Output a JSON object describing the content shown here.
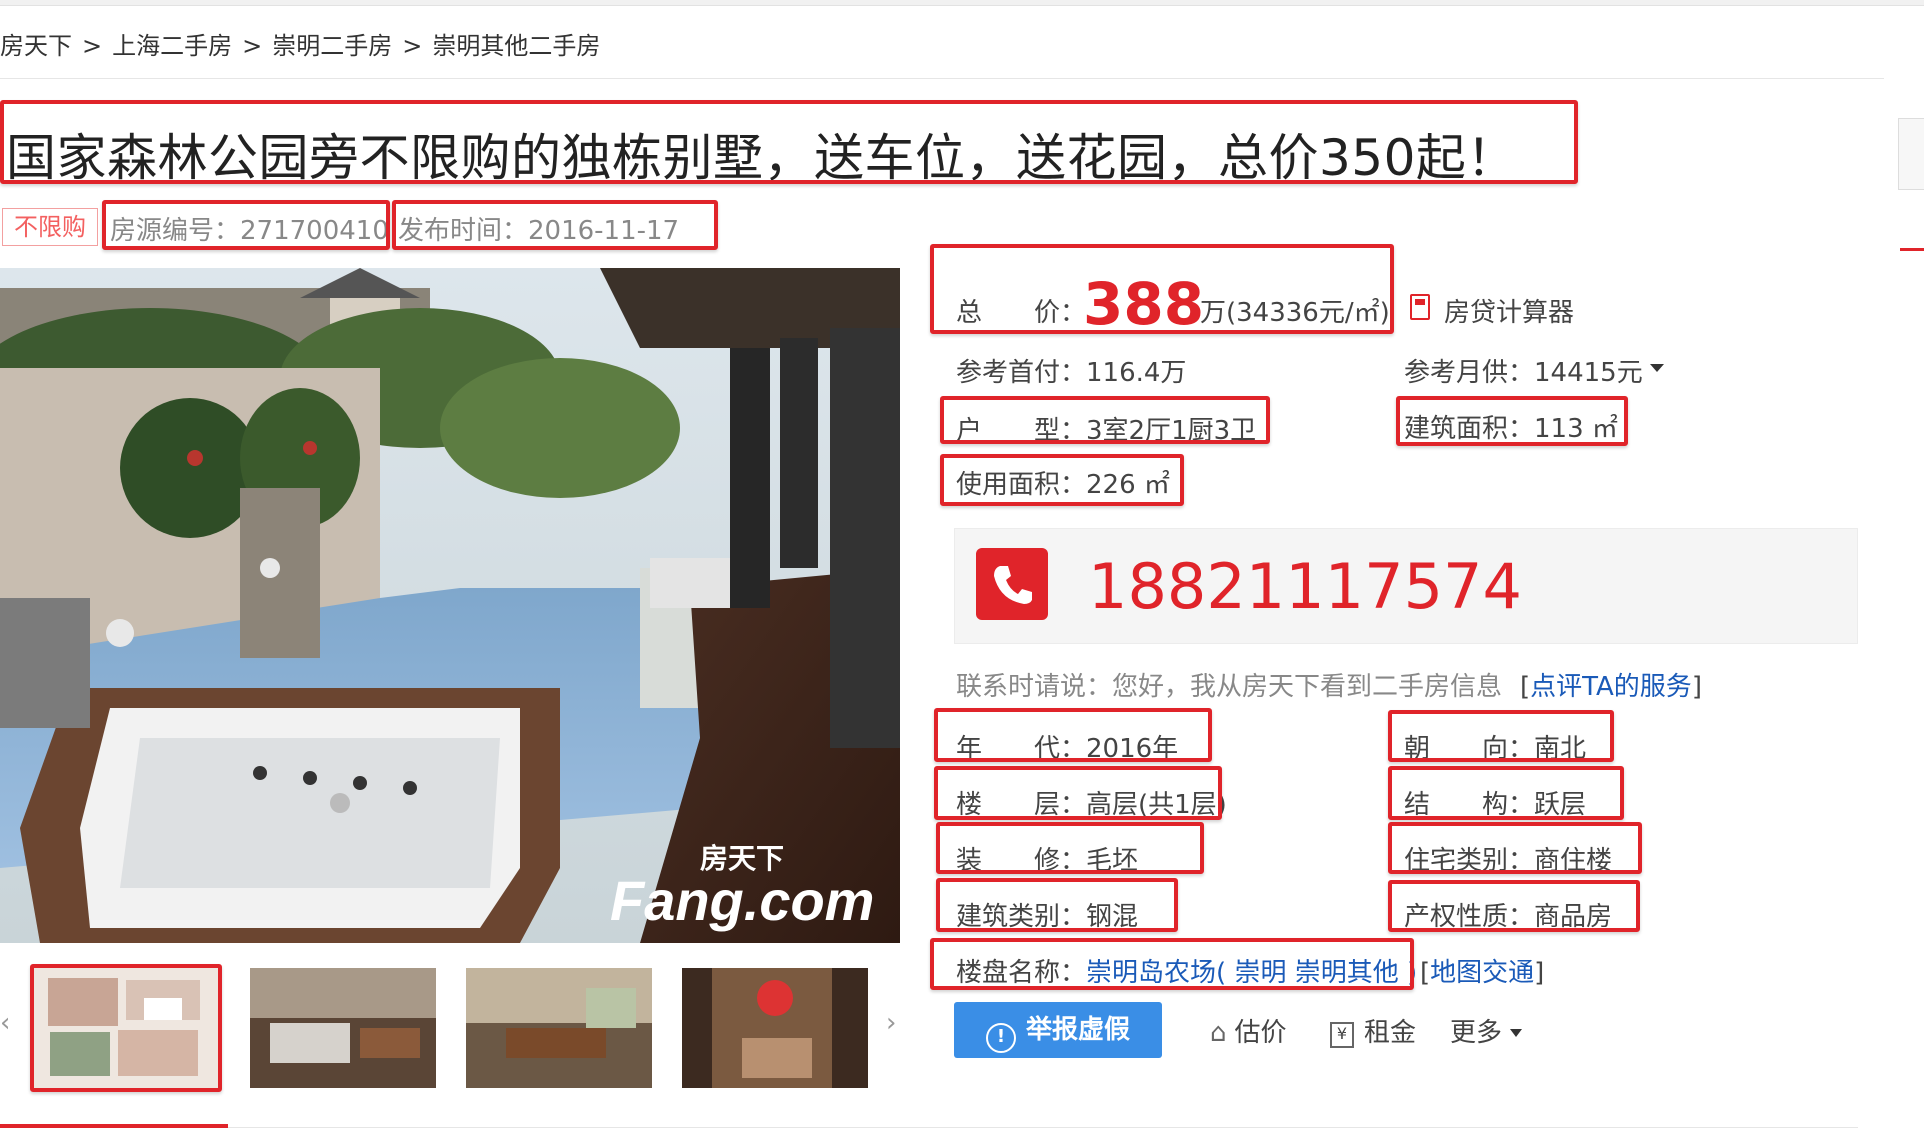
{
  "breadcrumb": {
    "items": [
      "房天下",
      "上海二手房",
      "崇明二手房",
      "崇明其他二手房"
    ],
    "separator": ">"
  },
  "listing": {
    "title": "国家森林公园旁不限购的独栋别墅，送车位，送花园，总价350起！",
    "tag": "不限购",
    "listing_id": "房源编号：271700410",
    "publish_time": "发布时间：2016-11-17"
  },
  "photo": {
    "watermark_cn": "房天下",
    "watermark_en": "Fang.com"
  },
  "price": {
    "label": "总　　价：",
    "value": "388",
    "unit": "万(34336元/㎡)",
    "calculator": "房贷计算器"
  },
  "payment": {
    "down_payment": "参考首付：116.4万",
    "monthly": "参考月供：14415元"
  },
  "specs": {
    "layout": "户　　型：3室2厅1厨3卫",
    "area": "建筑面积：113 ㎡",
    "usable_area": "使用面积：226 ㎡"
  },
  "contact": {
    "phone": "18821117574",
    "hint": "联系时请说：您好，我从房天下看到二手房信息",
    "review_link": "点评TA的服务"
  },
  "details": {
    "year": "年　　代：2016年",
    "orientation": "朝　　向：南北",
    "floor": "楼　　层：高层(共1层)",
    "structure": "结　　构：跃层",
    "decoration": "装　　修：毛坯",
    "residence_type": "住宅类别：商住楼",
    "building_type": "建筑类别：钢混",
    "property_right": "产权性质：商品房"
  },
  "estate": {
    "label": "楼盘名称：",
    "name": "崇明岛农场",
    "district": "崇明",
    "subdistrict": "崇明其他",
    "map_link": "地图交通"
  },
  "actions": {
    "report": "举报虚假",
    "estimate": "估价",
    "rent": "租金",
    "more": "更多"
  },
  "colors": {
    "accent_red": "#e0242a",
    "link_blue": "#1a5ab8",
    "report_blue": "#3a8ee6"
  }
}
